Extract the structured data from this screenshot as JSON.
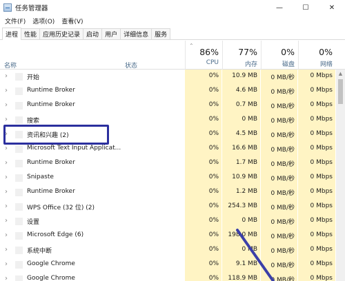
{
  "window": {
    "title": "任务管理器",
    "minimize": "—",
    "maximize": "☐",
    "close": "✕"
  },
  "menu": [
    "文件(F)",
    "选项(O)",
    "查看(V)"
  ],
  "tabs": [
    "进程",
    "性能",
    "应用历史记录",
    "启动",
    "用户",
    "详细信息",
    "服务"
  ],
  "header": {
    "name": "名称",
    "status": "状态",
    "cpu_pct": "86%",
    "cpu": "CPU",
    "mem_pct": "77%",
    "mem": "内存",
    "disk_pct": "0%",
    "disk": "磁盘",
    "net_pct": "0%",
    "net": "网络"
  },
  "processes": [
    {
      "name": "开始",
      "cpu": "0%",
      "mem": "10.9 MB",
      "disk": "0 MB/秒",
      "net": "0 Mbps"
    },
    {
      "name": "Runtime Broker",
      "cpu": "0%",
      "mem": "4.6 MB",
      "disk": "0 MB/秒",
      "net": "0 Mbps"
    },
    {
      "name": "Runtime Broker",
      "cpu": "0%",
      "mem": "0.7 MB",
      "disk": "0 MB/秒",
      "net": "0 Mbps"
    },
    {
      "name": "搜索",
      "cpu": "0%",
      "mem": "0 MB",
      "disk": "0 MB/秒",
      "net": "0 Mbps"
    },
    {
      "name": "资讯和兴趣 (2)",
      "cpu": "0%",
      "mem": "4.5 MB",
      "disk": "0 MB/秒",
      "net": "0 Mbps"
    },
    {
      "name": "Microsoft Text Input Applicat...",
      "cpu": "0%",
      "mem": "16.6 MB",
      "disk": "0 MB/秒",
      "net": "0 Mbps"
    },
    {
      "name": "Runtime Broker",
      "cpu": "0%",
      "mem": "1.7 MB",
      "disk": "0 MB/秒",
      "net": "0 Mbps"
    },
    {
      "name": "Snipaste",
      "cpu": "0%",
      "mem": "10.9 MB",
      "disk": "0 MB/秒",
      "net": "0 Mbps"
    },
    {
      "name": "Runtime Broker",
      "cpu": "0%",
      "mem": "1.2 MB",
      "disk": "0 MB/秒",
      "net": "0 Mbps"
    },
    {
      "name": "WPS Office (32 位) (2)",
      "cpu": "0%",
      "mem": "254.3 MB",
      "disk": "0 MB/秒",
      "net": "0 Mbps"
    },
    {
      "name": "设置",
      "cpu": "0%",
      "mem": "0 MB",
      "disk": "0 MB/秒",
      "net": "0 Mbps"
    },
    {
      "name": "Microsoft Edge (6)",
      "cpu": "0%",
      "mem": "198.0 MB",
      "disk": "0 MB/秒",
      "net": "0 Mbps"
    },
    {
      "name": "系统中断",
      "cpu": "0%",
      "mem": "0 MB",
      "disk": "0 MB/秒",
      "net": "0 Mbps"
    },
    {
      "name": "Google Chrome",
      "cpu": "0%",
      "mem": "9.1 MB",
      "disk": "0 MB/秒",
      "net": "0 Mbps"
    },
    {
      "name": "Google Chrome",
      "cpu": "0%",
      "mem": "118.9 MB",
      "disk": "0 MB/秒",
      "net": "0 Mbps"
    }
  ],
  "colors": {
    "heat": "#fff4c4",
    "highlight": "#2b2f9e",
    "arrow": "#3b3fa8"
  }
}
